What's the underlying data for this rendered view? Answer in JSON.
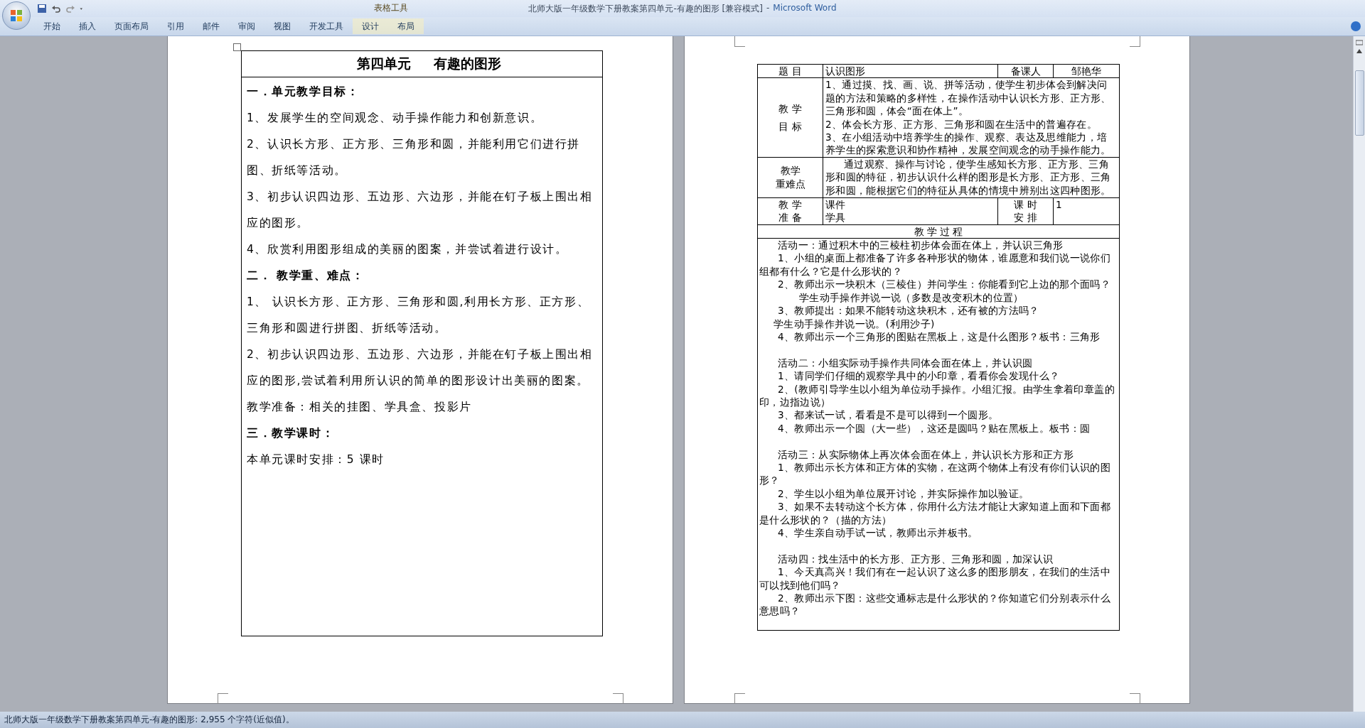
{
  "window": {
    "document_title": "北师大版一年级数学下册教案第四单元-有趣的图形 [兼容模式]",
    "separator": "-",
    "app_name": "Microsoft Word"
  },
  "contextual_group": "表格工具",
  "ribbon_tabs": [
    {
      "label": "开始",
      "selected": false,
      "contextual": false
    },
    {
      "label": "插入",
      "selected": false,
      "contextual": false
    },
    {
      "label": "页面布局",
      "selected": false,
      "contextual": false
    },
    {
      "label": "引用",
      "selected": false,
      "contextual": false
    },
    {
      "label": "邮件",
      "selected": false,
      "contextual": false
    },
    {
      "label": "审阅",
      "selected": false,
      "contextual": false
    },
    {
      "label": "视图",
      "selected": false,
      "contextual": false
    },
    {
      "label": "开发工具",
      "selected": false,
      "contextual": false
    },
    {
      "label": "设计",
      "selected": false,
      "contextual": true
    },
    {
      "label": "布局",
      "selected": false,
      "contextual": true
    }
  ],
  "left_page": {
    "title": [
      "第四单元",
      "有趣的图形"
    ],
    "paragraphs": [
      {
        "kind": "heading",
        "text": "一．单元教学目标："
      },
      {
        "kind": "body",
        "text": "1、发展学生的空间观念、动手操作能力和创新意识。"
      },
      {
        "kind": "body",
        "text": "2、认识长方形、正方形、三角形和圆，并能利用它们进行拼图、折纸等活动。"
      },
      {
        "kind": "body",
        "text": "3、初步认识四边形、五边形、六边形，并能在钉子板上围出相应的图形。"
      },
      {
        "kind": "body",
        "text": "4、欣赏利用图形组成的美丽的图案，并尝试着进行设计。"
      },
      {
        "kind": "heading",
        "text": "二．  教学重、难点："
      },
      {
        "kind": "body",
        "text": "1、  认识长方形、正方形、三角形和圆,利用长方形、正方形、三角形和圆进行拼图、折纸等活动。"
      },
      {
        "kind": "body",
        "text": "2、初步认识四边形、五边形、六边形，并能在钉子板上围出相应的图形,尝试着利用所认识的简单的图形设计出美丽的图案。"
      },
      {
        "kind": "body",
        "text": "教学准备：相关的挂图、学具盒、投影片"
      },
      {
        "kind": "heading",
        "text": "三．教学课时："
      },
      {
        "kind": "body",
        "text": "本单元课时安排：5 课时"
      }
    ]
  },
  "right_page": {
    "table": {
      "topic_label": "题  目",
      "topic": "认识图形",
      "preparer_label": "备课人",
      "preparer": "邹艳华",
      "goals_label": [
        "教  学",
        "目  标"
      ],
      "goals": [
        "1、通过摸、找、画、说、拼等活动，使学生初步体会到解决问题的方法和策略的多样性，在操作活动中认识长方形、正方形、三角形和圆，体会“面在体上”。",
        "2、体会长方形、正方形、三角形和圆在生活中的普遍存在。",
        "3、在小组活动中培养学生的操作、观察、表达及思维能力，培养学生的探索意识和协作精神，发展空间观念的动手操作能力。"
      ],
      "key_points_label": [
        "教学",
        "重难点"
      ],
      "key_points": "通过观察、操作与讨论，使学生感知长方形、正方形、三角形和圆的特征，初步认识什么样的图形是长方形、正方形、三角形和圆，能根据它们的特征从具体的情境中辨别出这四种图形。",
      "prep_label": [
        "教  学",
        "准  备"
      ],
      "prep": [
        "课件",
        "学具"
      ],
      "hours_label": [
        "课  时",
        "安  排"
      ],
      "hours": "1",
      "process_label": "教 学 过 程",
      "process": [
        {
          "kind": "activity",
          "text": "活动一：通过积木中的三棱柱初步体会面在体上，并认识三角形"
        },
        {
          "kind": "item",
          "text": "1、小组的桌面上都准备了许多各种形状的物体，谁愿意和我们说一说你们组都有什么？它是什么形状的？"
        },
        {
          "kind": "item",
          "text": "2、教师出示一块积木（三棱住）并问学生：你能看到它上边的那个面吗？"
        },
        {
          "kind": "deep",
          "text": "学生动手操作并说一说（多数是改变积木的位置）"
        },
        {
          "kind": "item",
          "text": "3、教师提出：如果不能转动这块积木，还有被的方法吗？"
        },
        {
          "kind": "sub",
          "text": "学生动手操作并说一说。(利用沙子)"
        },
        {
          "kind": "item",
          "text": "4、教师出示一个三角形的图贴在黑板上，这是什么图形？板书：三角形"
        },
        {
          "kind": "blank"
        },
        {
          "kind": "activity",
          "text": "活动二：小组实际动手操作共同体会面在体上，并认识圆"
        },
        {
          "kind": "item",
          "text": "1、请同学们仔细的观察学具中的小印章，看看你会发现什么？"
        },
        {
          "kind": "item",
          "text": "2、(教师引导学生以小组为单位动手操作。小组汇报。由学生拿着印章盖的印，边指边说）"
        },
        {
          "kind": "item",
          "text": "3、都来试一试，看看是不是可以得到一个圆形。"
        },
        {
          "kind": "item",
          "text": "4、教师出示一个圆（大一些），这还是圆吗？贴在黑板上。板书：圆"
        },
        {
          "kind": "blank"
        },
        {
          "kind": "activity",
          "text": "活动三：从实际物体上再次体会面在体上，并认识长方形和正方形"
        },
        {
          "kind": "item",
          "text": "1、教师出示长方体和正方体的实物，在这两个物体上有没有你们认识的图形？"
        },
        {
          "kind": "item",
          "text": "2、学生以小组为单位展开讨论，并实际操作加以验证。"
        },
        {
          "kind": "item",
          "text": "3、如果不去转动这个长方体，你用什么方法才能让大家知道上面和下面都是什么形状的？（描的方法）"
        },
        {
          "kind": "item",
          "text": "4、学生亲自动手试一试，教师出示并板书。"
        },
        {
          "kind": "blank"
        },
        {
          "kind": "activity",
          "text": "活动四：找生活中的长方形、正方形、三角形和圆，加深认识"
        },
        {
          "kind": "item",
          "text": "1、今天真高兴！我们有在一起认识了这么多的图形朋友，在我们的生活中可以找到他们吗？"
        },
        {
          "kind": "item",
          "text": "2、教师出示下图：这些交通标志是什么形状的？你知道它们分别表示什么意思吗？"
        }
      ]
    }
  },
  "status_bar": {
    "text": "北师大版一年级数学下册教案第四单元-有趣的图形: 2,955 个字符(近似值)。"
  }
}
